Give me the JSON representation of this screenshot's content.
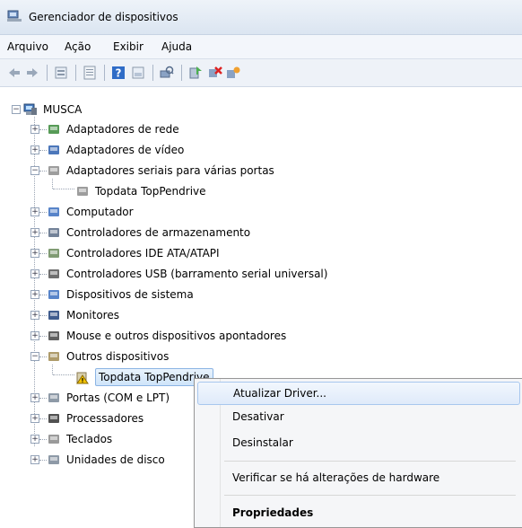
{
  "window": {
    "title": "Gerenciador de dispositivos"
  },
  "menu": [
    "Arquivo",
    "Ação",
    "Exibir",
    "Ajuda"
  ],
  "toolbar": [
    "back-icon",
    "forward-icon",
    "properties-view-icon",
    "device-view-icon",
    "help-icon",
    "show-hidden-icon",
    "scan-hardware-icon",
    "update-driver-icon",
    "disable-device-icon",
    "uninstall-icon"
  ],
  "tree": {
    "root": "MUSCA",
    "items": [
      {
        "label": "Adaptadores de rede",
        "icon": "network-adapter-icon"
      },
      {
        "label": "Adaptadores de vídeo",
        "icon": "display-adapter-icon"
      },
      {
        "label": "Adaptadores seriais para várias portas",
        "icon": "serial-adapter-icon",
        "expanded": true
      },
      {
        "label": "Topdata TopPendrive",
        "icon": "serial-device-icon",
        "child": true
      },
      {
        "label": "Computador",
        "icon": "computer-icon"
      },
      {
        "label": "Controladores de armazenamento",
        "icon": "storage-controller-icon"
      },
      {
        "label": "Controladores IDE ATA/ATAPI",
        "icon": "ide-controller-icon"
      },
      {
        "label": "Controladores USB (barramento serial universal)",
        "icon": "usb-controller-icon"
      },
      {
        "label": "Dispositivos de sistema",
        "icon": "system-device-icon"
      },
      {
        "label": "Monitores",
        "icon": "monitor-icon"
      },
      {
        "label": "Mouse e outros dispositivos apontadores",
        "icon": "mouse-icon"
      },
      {
        "label": "Outros dispositivos",
        "icon": "other-devices-icon",
        "expanded": true
      },
      {
        "label": "Topdata TopPendrive",
        "icon": "warning-device-icon",
        "child": true,
        "selected": true
      },
      {
        "label": "Portas (COM e LPT)",
        "icon": "ports-icon"
      },
      {
        "label": "Processadores",
        "icon": "processor-icon"
      },
      {
        "label": "Teclados",
        "icon": "keyboard-icon"
      },
      {
        "label": "Unidades de disco",
        "icon": "disk-drive-icon"
      }
    ]
  },
  "context_menu": {
    "update": "Atualizar Driver...",
    "disable": "Desativar",
    "uninstall": "Desinstalar",
    "scan": "Verificar se há alterações de hardware",
    "properties": "Propriedades"
  }
}
